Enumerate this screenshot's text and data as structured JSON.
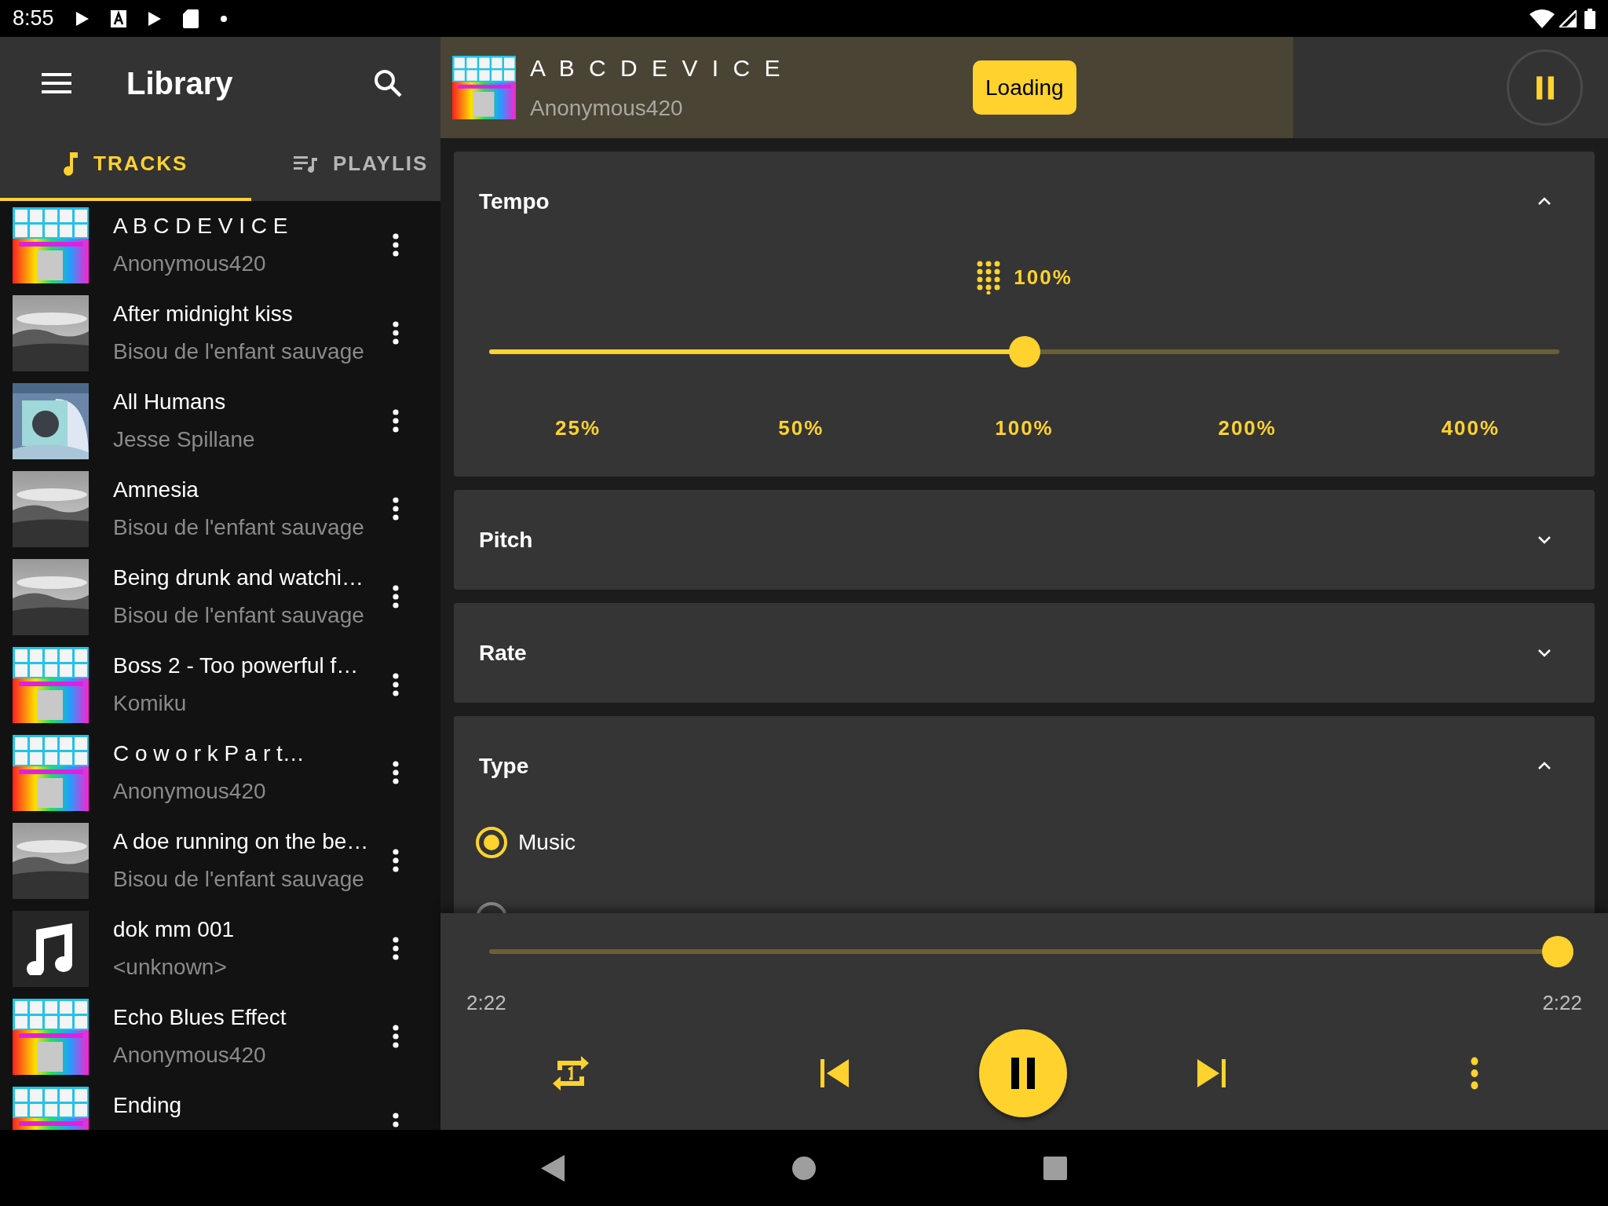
{
  "status_bar": {
    "time": "8:55"
  },
  "sidebar": {
    "title": "Library",
    "tabs": [
      {
        "label": "TRACKS",
        "selected": true
      },
      {
        "label": "PLAYLIS",
        "selected": false
      }
    ],
    "tracks": [
      {
        "title": "A B C D E V I C E",
        "artist": "Anonymous420",
        "kind": "picture"
      },
      {
        "title": "After midnight kiss",
        "artist": "Bisou de l'enfant sauvage",
        "kind": "picture"
      },
      {
        "title": "All Humans",
        "artist": "Jesse Spillane",
        "kind": "picture"
      },
      {
        "title": "Amnesia",
        "artist": "Bisou de l'enfant sauvage",
        "kind": "picture"
      },
      {
        "title": "Being drunk and watchi…",
        "artist": "Bisou de l'enfant sauvage",
        "kind": "picture"
      },
      {
        "title": "Boss 2 - Too powerful f…",
        "artist": "Komiku",
        "kind": "picture"
      },
      {
        "title": "C o w o r k P a r t…",
        "artist": "Anonymous420",
        "kind": "picture"
      },
      {
        "title": "A doe running on the be…",
        "artist": "Bisou de l'enfant sauvage",
        "kind": "picture"
      },
      {
        "title": "dok mm 001",
        "artist": "<unknown>",
        "kind": "icon"
      },
      {
        "title": "Echo Blues Effect",
        "artist": "Anonymous420",
        "kind": "picture"
      },
      {
        "title": "Ending",
        "kind": "picture"
      }
    ]
  },
  "now_playing": {
    "title": "A B C D E V I C E",
    "artist": "Anonymous420",
    "badge": "Loading",
    "playing": true
  },
  "effects": [
    {
      "title": "Tempo",
      "expanded": true,
      "kind": "slider",
      "value": "100%",
      "level": 0.5,
      "ticks": [
        "25%",
        "50%",
        "100%",
        "200%",
        "400%"
      ]
    },
    {
      "title": "Pitch",
      "expanded": false
    },
    {
      "title": "Rate",
      "expanded": false
    },
    {
      "title": "Type",
      "expanded": true,
      "kind": "radio",
      "options": [
        {
          "label": "Music",
          "selected": true
        },
        {
          "selected": false
        }
      ]
    }
  ],
  "player": {
    "level": 1,
    "elapsed": "2:22",
    "duration": "2:22",
    "playing": true
  }
}
